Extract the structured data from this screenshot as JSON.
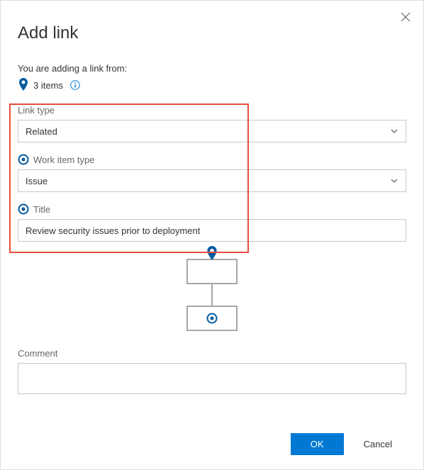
{
  "dialog": {
    "title": "Add link",
    "subtitle": "You are adding a link from:",
    "items_count": "3 items"
  },
  "form": {
    "link_type_label": "Link type",
    "link_type_value": "Related",
    "work_item_type_label": "Work item type",
    "work_item_type_value": "Issue",
    "title_label": "Title",
    "title_value": "Review security issues prior to deployment",
    "comment_label": "Comment",
    "comment_value": ""
  },
  "footer": {
    "ok_label": "OK",
    "cancel_label": "Cancel"
  },
  "colors": {
    "accent": "#0078d4",
    "pin": "#005a9e",
    "highlight": "#e74c3c"
  }
}
